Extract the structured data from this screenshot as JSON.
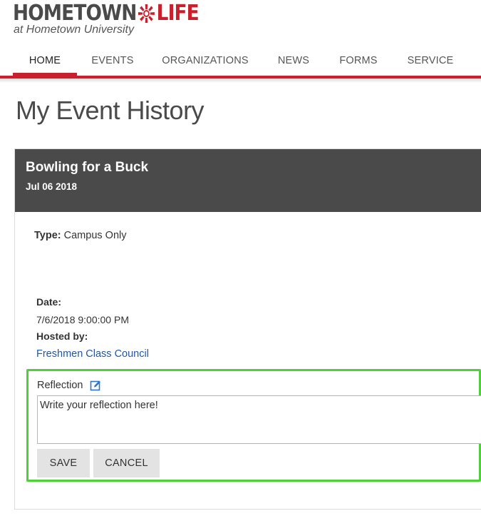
{
  "brand": {
    "word1": "HOMETOWN",
    "word2": "LIFE",
    "tagline": "at Hometown University",
    "accent_color": "#c8202c",
    "logo_icon": "starburst-icon"
  },
  "nav": {
    "items": [
      {
        "label": "HOME",
        "active": true
      },
      {
        "label": "EVENTS",
        "active": false
      },
      {
        "label": "ORGANIZATIONS",
        "active": false
      },
      {
        "label": "NEWS",
        "active": false
      },
      {
        "label": "FORMS",
        "active": false
      },
      {
        "label": "SERVICE",
        "active": false
      }
    ]
  },
  "page": {
    "title": "My Event History"
  },
  "event": {
    "name": "Bowling for a Buck",
    "date_short": "Jul 06 2018",
    "type_label": "Type:",
    "type_value": "Campus Only",
    "date_label": "Date:",
    "date_value": "7/6/2018 9:00:00 PM",
    "hosted_label": "Hosted by:",
    "host": "Freshmen Class Council"
  },
  "reflection": {
    "label": "Reflection",
    "edit_icon": "edit-icon",
    "placeholder": "Write your reflection here!",
    "value": "",
    "save_label": "SAVE",
    "cancel_label": "CANCEL",
    "highlight_color": "#4cd137"
  }
}
